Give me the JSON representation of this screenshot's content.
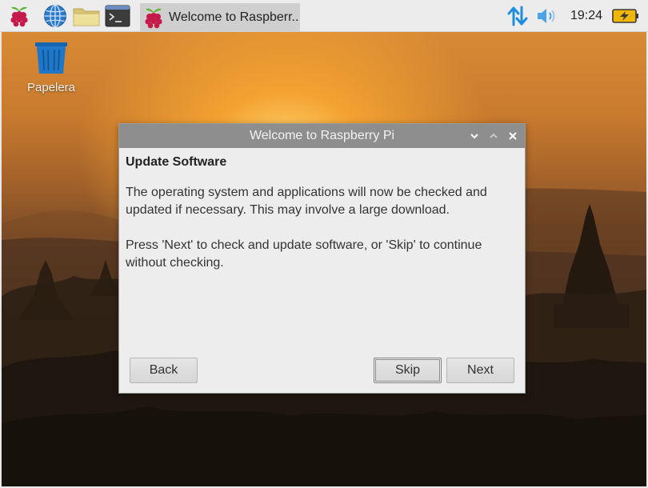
{
  "taskbar": {
    "task_title": "Welcome to Raspberr...",
    "clock": "19:24"
  },
  "desktop": {
    "trash_label": "Papelera"
  },
  "dialog": {
    "title": "Welcome to Raspberry Pi",
    "heading": "Update Software",
    "paragraph1": "The operating system and applications will now be checked and updated if necessary. This may involve a large download.",
    "paragraph2": "Press 'Next' to check and update software, or 'Skip' to continue without checking.",
    "back_label": "Back",
    "skip_label": "Skip",
    "next_label": "Next"
  },
  "colors": {
    "raspberry": "#c51a4a",
    "leaf": "#5fb236",
    "globe": "#2b79c9",
    "folder": "#e8d58a",
    "trash": "#1f77c9",
    "network": "#1e8fe0",
    "battery": "#f2b705"
  },
  "icons": [
    "raspberry-menu-icon",
    "web-browser-icon",
    "file-manager-icon",
    "terminal-icon",
    "network-icon",
    "volume-icon",
    "battery-icon",
    "trash-icon",
    "minimize-icon",
    "maximize-icon",
    "close-icon"
  ]
}
